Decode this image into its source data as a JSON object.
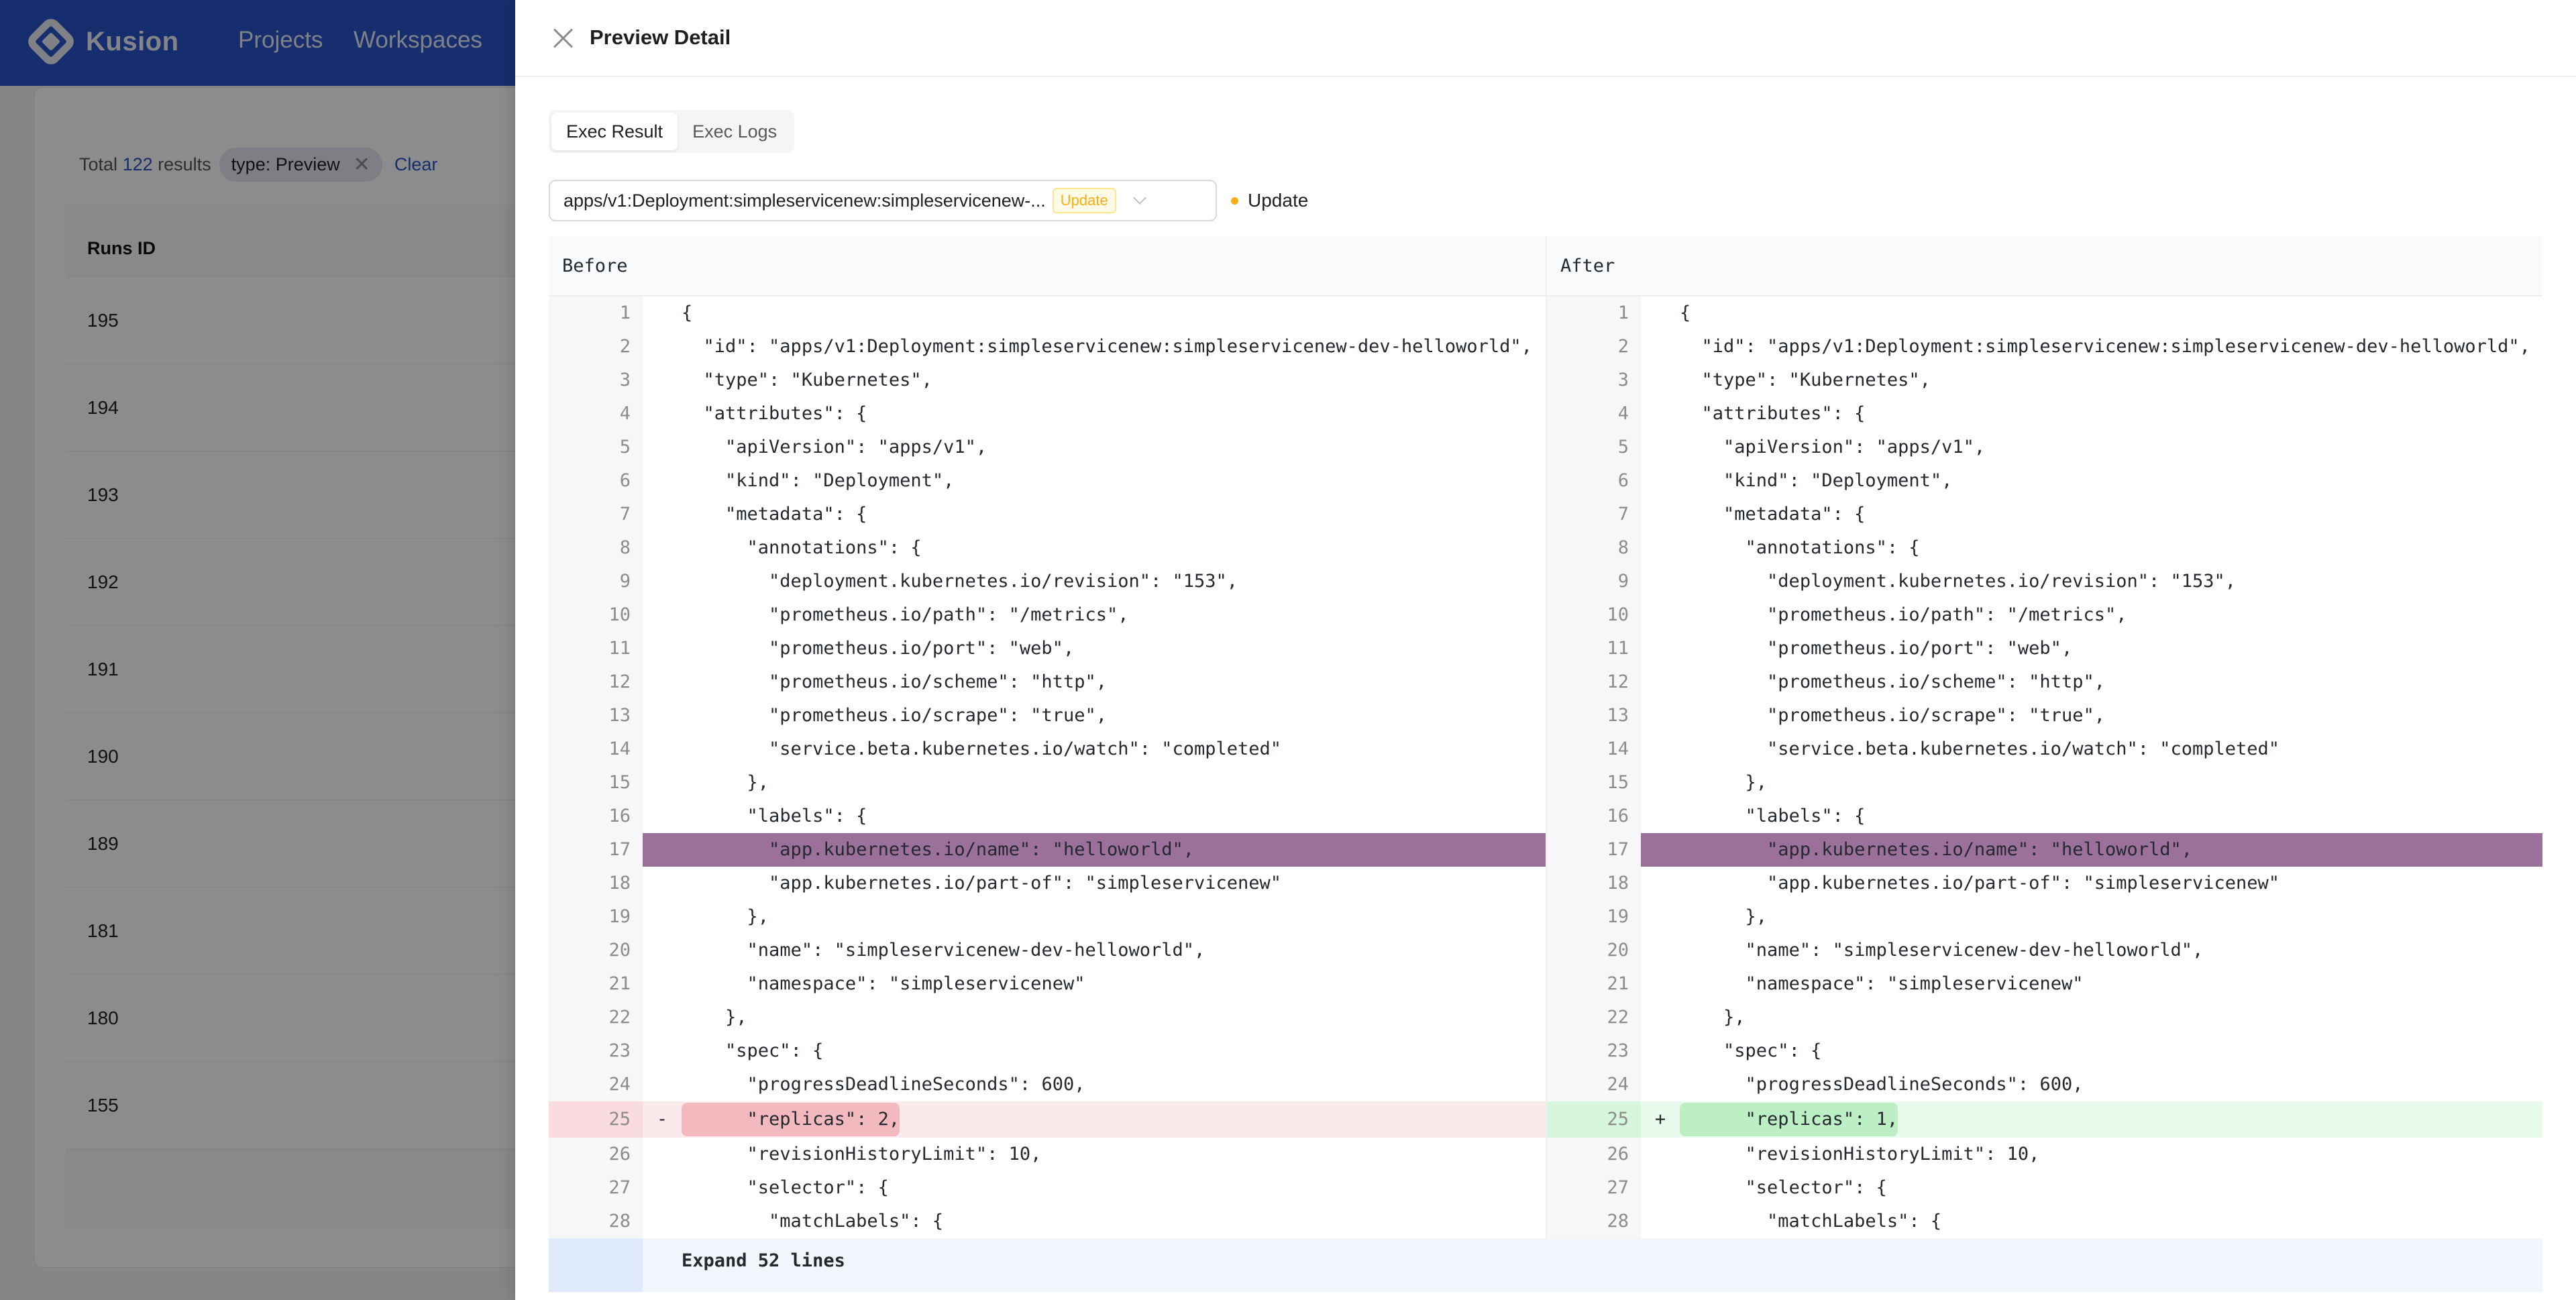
{
  "app": {
    "brand": "Kusion",
    "nav": [
      "Projects",
      "Workspaces"
    ]
  },
  "list": {
    "total_prefix": "Total",
    "total_count": "122",
    "total_suffix": "results",
    "filter_chip": "type: Preview",
    "clear_label": "Clear",
    "column_header": "Runs ID",
    "rows": [
      "195",
      "194",
      "193",
      "192",
      "191",
      "190",
      "189",
      "181",
      "180",
      "155"
    ]
  },
  "drawer": {
    "title": "Preview Detail",
    "tabs": [
      {
        "label": "Exec Result",
        "active": true
      },
      {
        "label": "Exec Logs",
        "active": false
      }
    ],
    "resource_select": {
      "value": "apps/v1:Deployment:simpleservicenew:simpleservicenew-...",
      "tag": "Update"
    },
    "status": {
      "label": "Update",
      "color": "#faad14"
    }
  },
  "diff": {
    "before_label": "Before",
    "after_label": "After",
    "expand_label": "Expand 52 lines",
    "lines": [
      {
        "n": 1,
        "before": "{",
        "after": "{"
      },
      {
        "n": 2,
        "before": "  \"id\": \"apps/v1:Deployment:simpleservicenew:simpleservicenew-dev-helloworld\",",
        "after": "  \"id\": \"apps/v1:Deployment:simpleservicenew:simpleservicenew-dev-helloworld\","
      },
      {
        "n": 3,
        "before": "  \"type\": \"Kubernetes\",",
        "after": "  \"type\": \"Kubernetes\","
      },
      {
        "n": 4,
        "before": "  \"attributes\": {",
        "after": "  \"attributes\": {"
      },
      {
        "n": 5,
        "before": "    \"apiVersion\": \"apps/v1\",",
        "after": "    \"apiVersion\": \"apps/v1\","
      },
      {
        "n": 6,
        "before": "    \"kind\": \"Deployment\",",
        "after": "    \"kind\": \"Deployment\","
      },
      {
        "n": 7,
        "before": "    \"metadata\": {",
        "after": "    \"metadata\": {"
      },
      {
        "n": 8,
        "before": "      \"annotations\": {",
        "after": "      \"annotations\": {"
      },
      {
        "n": 9,
        "before": "        \"deployment.kubernetes.io/revision\": \"153\",",
        "after": "        \"deployment.kubernetes.io/revision\": \"153\","
      },
      {
        "n": 10,
        "before": "        \"prometheus.io/path\": \"/metrics\",",
        "after": "        \"prometheus.io/path\": \"/metrics\","
      },
      {
        "n": 11,
        "before": "        \"prometheus.io/port\": \"web\",",
        "after": "        \"prometheus.io/port\": \"web\","
      },
      {
        "n": 12,
        "before": "        \"prometheus.io/scheme\": \"http\",",
        "after": "        \"prometheus.io/scheme\": \"http\","
      },
      {
        "n": 13,
        "before": "        \"prometheus.io/scrape\": \"true\",",
        "after": "        \"prometheus.io/scrape\": \"true\","
      },
      {
        "n": 14,
        "before": "        \"service.beta.kubernetes.io/watch\": \"completed\"",
        "after": "        \"service.beta.kubernetes.io/watch\": \"completed\""
      },
      {
        "n": 15,
        "before": "      },",
        "after": "      },"
      },
      {
        "n": 16,
        "before": "      \"labels\": {",
        "after": "      \"labels\": {"
      },
      {
        "n": 17,
        "before": "        \"app.kubernetes.io/name\": \"helloworld\",",
        "after": "        \"app.kubernetes.io/name\": \"helloworld\",",
        "highlight": true
      },
      {
        "n": 18,
        "before": "        \"app.kubernetes.io/part-of\": \"simpleservicenew\"",
        "after": "        \"app.kubernetes.io/part-of\": \"simpleservicenew\""
      },
      {
        "n": 19,
        "before": "      },",
        "after": "      },"
      },
      {
        "n": 20,
        "before": "      \"name\": \"simpleservicenew-dev-helloworld\",",
        "after": "      \"name\": \"simpleservicenew-dev-helloworld\","
      },
      {
        "n": 21,
        "before": "      \"namespace\": \"simpleservicenew\"",
        "after": "      \"namespace\": \"simpleservicenew\""
      },
      {
        "n": 22,
        "before": "    },",
        "after": "    },"
      },
      {
        "n": 23,
        "before": "    \"spec\": {",
        "after": "    \"spec\": {"
      },
      {
        "n": 24,
        "before": "      \"progressDeadlineSeconds\": 600,",
        "after": "      \"progressDeadlineSeconds\": 600,"
      },
      {
        "n": 25,
        "before": "      \"replicas\": 2,",
        "after": "      \"replicas\": 1,",
        "changed": true,
        "before_marker": "-",
        "after_marker": "+"
      },
      {
        "n": 26,
        "before": "      \"revisionHistoryLimit\": 10,",
        "after": "      \"revisionHistoryLimit\": 10,"
      },
      {
        "n": 27,
        "before": "      \"selector\": {",
        "after": "      \"selector\": {"
      },
      {
        "n": 28,
        "before": "        \"matchLabels\": {",
        "after": "        \"matchLabels\": {"
      }
    ]
  }
}
